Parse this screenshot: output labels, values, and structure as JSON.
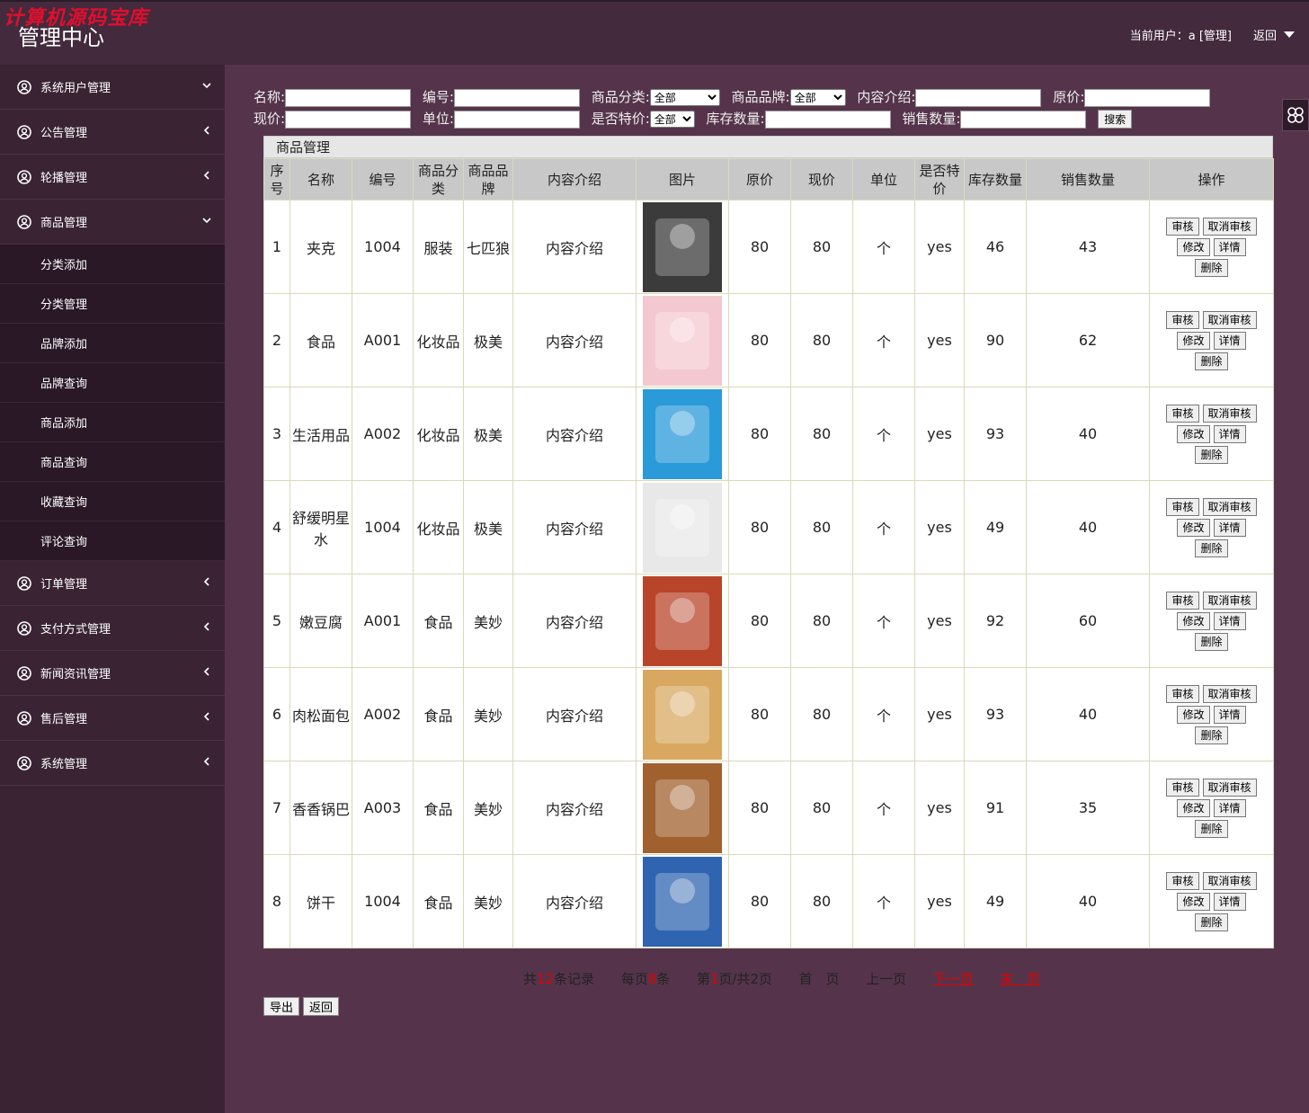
{
  "header": {
    "watermark": "计算机源码宝库",
    "title": "管理中心",
    "user_label": "当前用户：a [管理]",
    "back_label": "返回"
  },
  "sidebar": {
    "groups": [
      {
        "label": "系统用户管理",
        "expanded": true
      },
      {
        "label": "公告管理",
        "expanded": false
      },
      {
        "label": "轮播管理",
        "expanded": false
      },
      {
        "label": "商品管理",
        "expanded": true
      },
      {
        "label": "订单管理",
        "expanded": false
      },
      {
        "label": "支付方式管理",
        "expanded": false
      },
      {
        "label": "新闻资讯管理",
        "expanded": false
      },
      {
        "label": "售后管理",
        "expanded": false
      },
      {
        "label": "系统管理",
        "expanded": false
      }
    ],
    "sub_items": [
      "分类添加",
      "分类管理",
      "品牌添加",
      "品牌查询",
      "商品添加",
      "商品查询",
      "收藏查询",
      "评论查询"
    ]
  },
  "search": {
    "name_label": "名称:",
    "code_label": "编号:",
    "category_label": "商品分类:",
    "category_value": "全部",
    "brand_label": "商品品牌:",
    "brand_value": "全部",
    "intro_label": "内容介绍:",
    "orig_label": "原价:",
    "cur_label": "现价:",
    "unit_label": "单位:",
    "special_label": "是否特价:",
    "special_value": "全部",
    "stock_label": "库存数量:",
    "sales_label": "销售数量:",
    "search_button": "搜索"
  },
  "table": {
    "title": "商品管理",
    "headers": [
      "序号",
      "名称",
      "编号",
      "商品分类",
      "商品品牌",
      "内容介绍",
      "图片",
      "原价",
      "现价",
      "单位",
      "是否特价",
      "库存数量",
      "销售数量",
      "操作"
    ],
    "rows": [
      {
        "no": "1",
        "name": "夹克",
        "code": "1004",
        "cat": "服装",
        "brand": "七匹狼",
        "intro": "内容介绍",
        "orig": "80",
        "cur": "80",
        "unit": "个",
        "special": "yes",
        "stock": "46",
        "sales": "43"
      },
      {
        "no": "2",
        "name": "食品",
        "code": "A001",
        "cat": "化妆品",
        "brand": "极美",
        "intro": "内容介绍",
        "orig": "80",
        "cur": "80",
        "unit": "个",
        "special": "yes",
        "stock": "90",
        "sales": "62"
      },
      {
        "no": "3",
        "name": "生活用品",
        "code": "A002",
        "cat": "化妆品",
        "brand": "极美",
        "intro": "内容介绍",
        "orig": "80",
        "cur": "80",
        "unit": "个",
        "special": "yes",
        "stock": "93",
        "sales": "40"
      },
      {
        "no": "4",
        "name": "舒缓明星水",
        "code": "1004",
        "cat": "化妆品",
        "brand": "极美",
        "intro": "内容介绍",
        "orig": "80",
        "cur": "80",
        "unit": "个",
        "special": "yes",
        "stock": "49",
        "sales": "40"
      },
      {
        "no": "5",
        "name": "嫩豆腐",
        "code": "A001",
        "cat": "食品",
        "brand": "美妙",
        "intro": "内容介绍",
        "orig": "80",
        "cur": "80",
        "unit": "个",
        "special": "yes",
        "stock": "92",
        "sales": "60"
      },
      {
        "no": "6",
        "name": "肉松面包",
        "code": "A002",
        "cat": "食品",
        "brand": "美妙",
        "intro": "内容介绍",
        "orig": "80",
        "cur": "80",
        "unit": "个",
        "special": "yes",
        "stock": "93",
        "sales": "40"
      },
      {
        "no": "7",
        "name": "香香锅巴",
        "code": "A003",
        "cat": "食品",
        "brand": "美妙",
        "intro": "内容介绍",
        "orig": "80",
        "cur": "80",
        "unit": "个",
        "special": "yes",
        "stock": "91",
        "sales": "35"
      },
      {
        "no": "8",
        "name": "饼干",
        "code": "1004",
        "cat": "食品",
        "brand": "美妙",
        "intro": "内容介绍",
        "orig": "80",
        "cur": "80",
        "unit": "个",
        "special": "yes",
        "stock": "49",
        "sales": "40"
      }
    ],
    "thumb_colors": [
      "#3b3b3b",
      "#f4c8d0",
      "#2a9ad8",
      "#e8e8e8",
      "#b8452a",
      "#d9a860",
      "#a0612e",
      "#2f64b0"
    ],
    "ops": {
      "approve": "审核",
      "unapprove": "取消审核",
      "edit": "修改",
      "detail": "详情",
      "delete": "删除"
    }
  },
  "pager": {
    "total_pre": "共",
    "total": "12",
    "total_post": "条记录",
    "per_pre": "每页",
    "per": "8",
    "per_post": "条",
    "page_pre": "第",
    "page": "1",
    "page_post": "页/共2页",
    "first": "首　页",
    "prev": "上一页",
    "next": "下一页",
    "last": "末　页"
  },
  "bottom": {
    "export": "导出",
    "back": "返回"
  }
}
